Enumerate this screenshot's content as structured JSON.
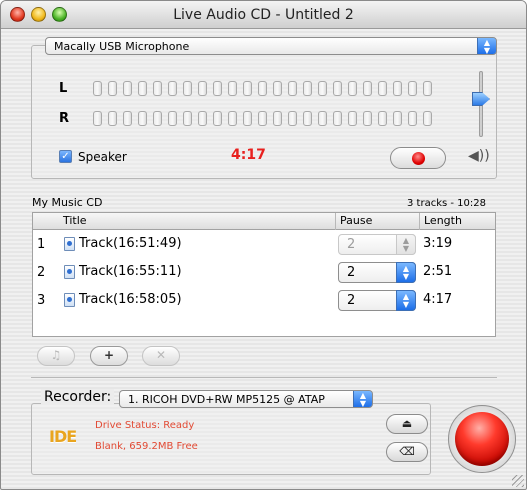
{
  "window": {
    "title": "Live Audio CD - Untitled 2"
  },
  "input": {
    "source": "Macally USB Microphone",
    "left_label": "L",
    "right_label": "R",
    "speaker_label": "Speaker",
    "speaker_checked": true,
    "elapsed": "4:17",
    "icons": {
      "record": "record-icon",
      "volume": "speaker-volume-icon"
    }
  },
  "cd": {
    "name": "My Music CD",
    "summary": "3 tracks - 10:28",
    "columns": [
      "Title",
      "Pause",
      "Length"
    ],
    "tracks": [
      {
        "num": "1",
        "title": "Track(16:51:49)",
        "pause": "2",
        "pause_enabled": false,
        "length": "3:19"
      },
      {
        "num": "2",
        "title": "Track(16:55:11)",
        "pause": "2",
        "pause_enabled": true,
        "length": "2:51"
      },
      {
        "num": "3",
        "title": "Track(16:58:05)",
        "pause": "2",
        "pause_enabled": true,
        "length": "4:17"
      }
    ],
    "buttons": {
      "music": "♫",
      "add": "+",
      "remove": "✕"
    }
  },
  "recorder": {
    "label": "Recorder:",
    "device": "1. RICOH DVD+RW MP5125 @ ATAP",
    "badge": "IDE",
    "status_line1": "Drive Status: Ready",
    "status_line2": "Blank, 659.2MB Free",
    "icons": {
      "eject": "eject-icon",
      "erase": "erase-icon",
      "burn": "record-button-icon"
    }
  },
  "colors": {
    "accent": "#2a73e0",
    "alert": "#e8201e",
    "status": "#e24a34",
    "badge": "#e9a51f"
  }
}
